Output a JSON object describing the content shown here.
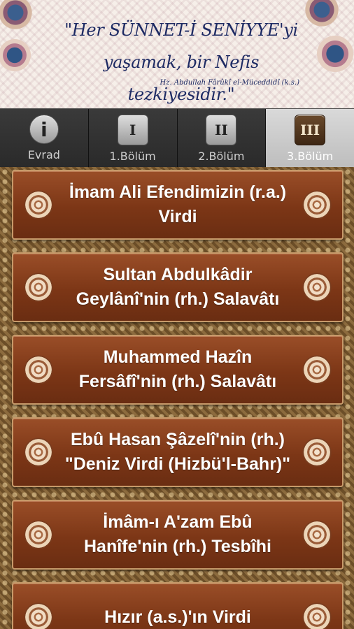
{
  "banner": {
    "quote_line1": "\"Her SÜNNET-İ SENİYYE'yi",
    "quote_line2": "yaşamak, bir Nefis tezkiyesidir.\"",
    "author": "Hz. Abdullah Fârûkî el-Müceddidî (k.s.)"
  },
  "tabs": [
    {
      "label": "Evrad",
      "icon_text": "i",
      "icon": "info-icon",
      "active": false
    },
    {
      "label": "1.Bölüm",
      "icon_text": "I",
      "icon": "roman-one-icon",
      "active": false
    },
    {
      "label": "2.Bölüm",
      "icon_text": "II",
      "icon": "roman-two-icon",
      "active": false
    },
    {
      "label": "3.Bölüm",
      "icon_text": "III",
      "icon": "roman-three-icon",
      "active": true
    }
  ],
  "items": [
    {
      "title": "İmam Ali Efendimizin (r.a.) Virdi"
    },
    {
      "title": "Sultan Abdulkâdir Geylânî'nin (rh.) Salavâtı"
    },
    {
      "title": "Muhammed Hazîn Fersâfî'nin (rh.) Salavâtı"
    },
    {
      "title": "Ebû Hasan Şâzelî'nin (rh.) \"Deniz Virdi (Hizbü'l-Bahr)\""
    },
    {
      "title": "İmâm-ı A'zam Ebû Hanîfe'nin (rh.) Tesbîhi"
    },
    {
      "title": "Hızır (a.s.)'ın Virdi"
    }
  ],
  "colors": {
    "item_bg": "#7c3616",
    "item_border": "#c79a6a",
    "banner_text": "#1d2a63",
    "tab_bg": "#2a2a2a",
    "tab_active_bg": "#bdbdbd"
  }
}
